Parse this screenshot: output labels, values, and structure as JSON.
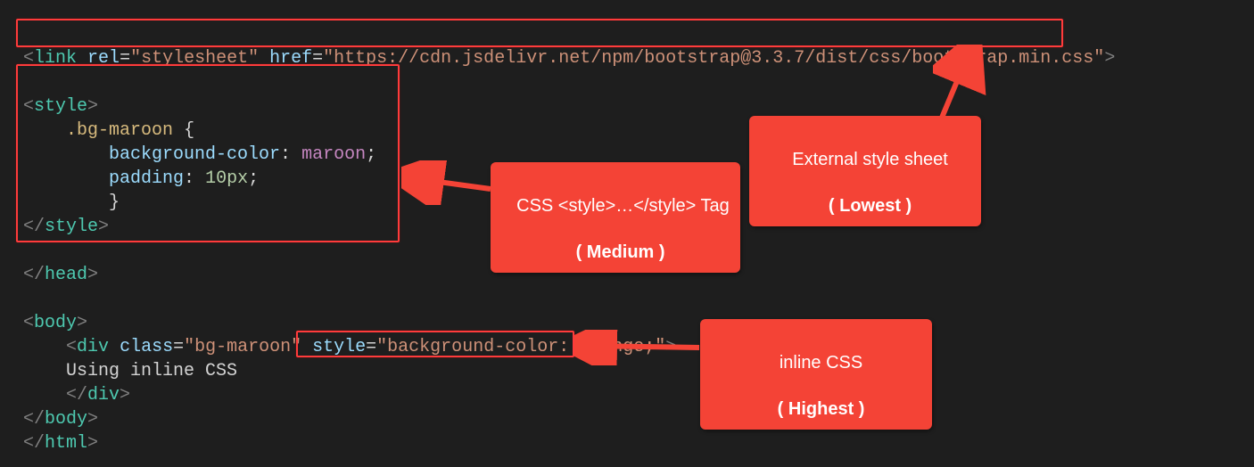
{
  "code": {
    "link_open1": "<",
    "link_tag": "link",
    "link_sp1": " ",
    "rel_attr": "rel",
    "eq": "=",
    "rel_val": "\"stylesheet\"",
    "link_sp2": " ",
    "href_attr": "href",
    "href_val": "\"https://cdn.jsdelivr.net/npm/bootstrap@3.3.7/dist/css/bootstrap.min.css\"",
    "link_close": ">",
    "style_open_br1": "<",
    "style_open_tag": "style",
    "style_open_br2": ">",
    "css_indent1": "    ",
    "css_sel": ".bg-maroon",
    "css_sp1": " ",
    "css_ob": "{",
    "css_indent2": "        ",
    "css_prop1": "background-color",
    "css_colon": ":",
    "css_sp2": " ",
    "css_val1": "maroon",
    "css_semi": ";",
    "css_prop2": "padding",
    "css_val2": "10px",
    "css_cb": "}",
    "style_close_br1": "</",
    "style_close_tag": "style",
    "style_close_br2": ">",
    "head_close_br1": "</",
    "head_close_tag": "head",
    "head_close_br2": ">",
    "body_open_br1": "<",
    "body_open_tag": "body",
    "body_open_br2": ">",
    "div_indent": "    ",
    "div_open_br1": "<",
    "div_tag": "div",
    "div_sp1": " ",
    "class_attr": "class",
    "class_val": "\"bg-maroon\"",
    "div_sp2": " ",
    "style_attr": "style",
    "style_val": "\"background-color: orange;\"",
    "div_open_br2": ">",
    "div_text": "Using inline CSS",
    "div_close_br1": "</",
    "div_close_br2": ">",
    "body_close_br1": "</",
    "body_close_tag": "body",
    "body_close_br2": ">",
    "html_close_br1": "</",
    "html_close_tag": "html",
    "html_close_br2": ">"
  },
  "callouts": {
    "external_line1": "External style sheet",
    "external_line2": "( Lowest )",
    "style_line1": "CSS <style>…</style> Tag",
    "style_line2": "( Medium )",
    "inline_line1": "inline CSS",
    "inline_line2": "( Highest )"
  }
}
